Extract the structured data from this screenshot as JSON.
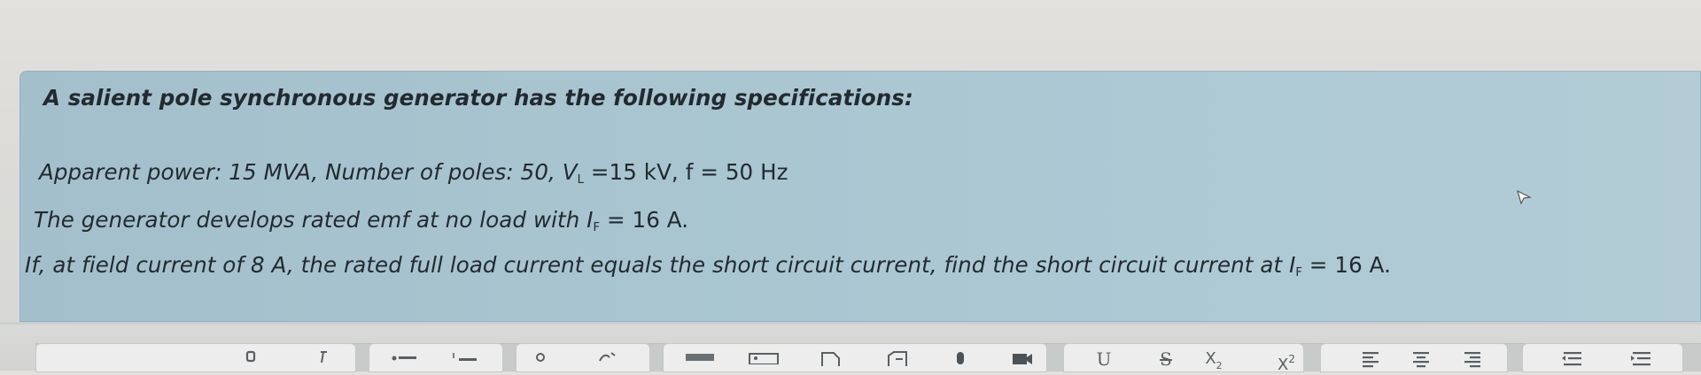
{
  "question": {
    "line1": "A salient pole synchronous generator has the following specifications:",
    "line2_prefix": "Apparent power: 15 MVA, Number of poles: 50, V",
    "line2_sub": "L",
    "line2_suffix": " =15 kV, f = 50 Hz",
    "line3_prefix": "The generator develops rated emf at no load with I",
    "line3_sub": "F",
    "line3_suffix": " = 16 A.",
    "line4_prefix": "If, at field current of 8 A, the rated full load current equals the short circuit current, find the short circuit current at I",
    "line4_sub": "F",
    "line4_suffix": " = 16 A."
  },
  "toolbar": {
    "underline": "U",
    "strikethrough": "S",
    "subscript_base": "X",
    "subscript_mark": "2",
    "superscript_base": "X",
    "superscript_mark": "2"
  },
  "colors": {
    "card_background": "#a9c6d1",
    "text": "#222a30",
    "toolbar_icon": "#5a5f63"
  },
  "icons": [
    "cursor-icon",
    "bold-icon",
    "italic-icon",
    "bullet-list-icon",
    "numbered-list-icon",
    "link-icon",
    "unlink-icon",
    "image-icon",
    "media-icon",
    "file-icon",
    "formula-icon",
    "mic-icon",
    "video-icon",
    "underline-icon",
    "strikethrough-icon",
    "subscript-icon",
    "superscript-icon",
    "align-left-icon",
    "align-center-icon",
    "align-right-icon",
    "outdent-icon",
    "indent-icon"
  ]
}
